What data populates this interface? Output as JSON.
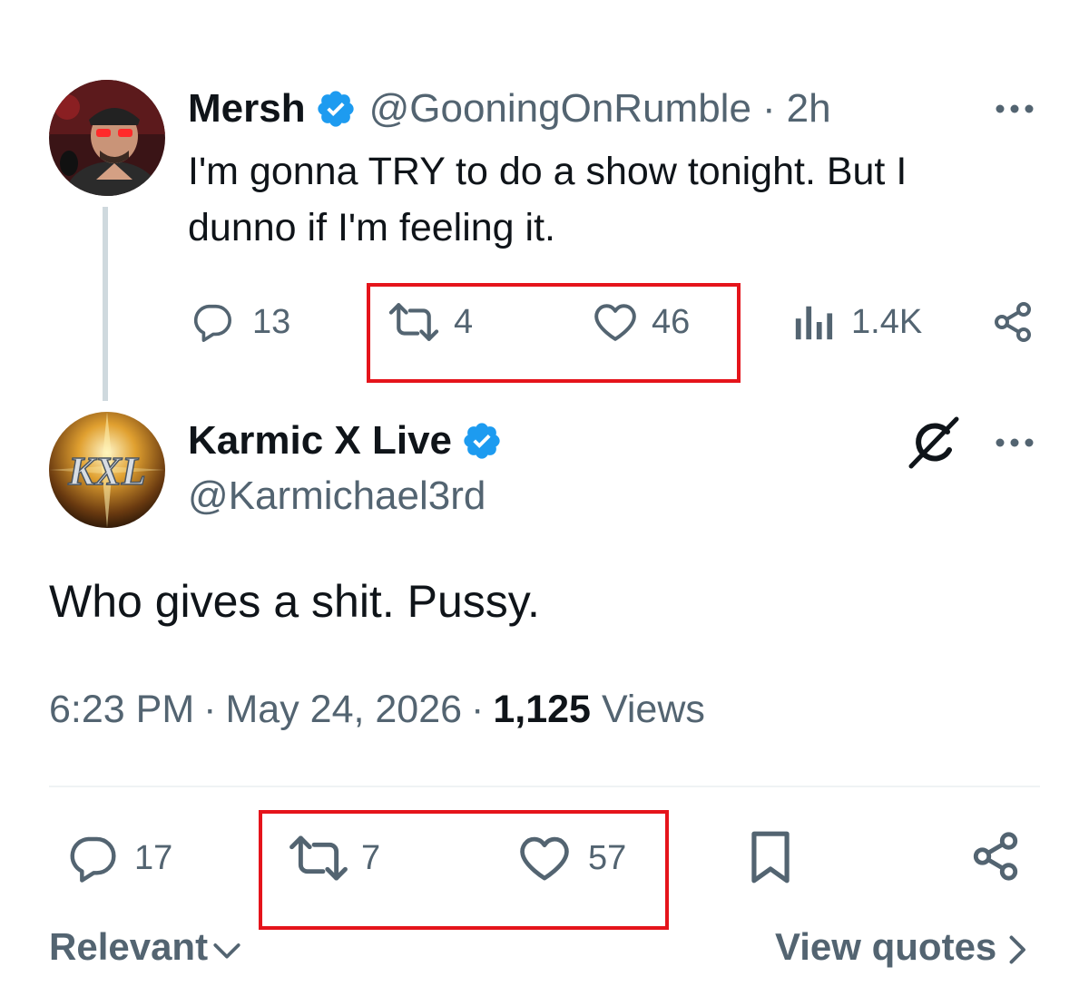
{
  "parent_tweet": {
    "display_name": "Mersh",
    "handle": "@GooningOnRumble",
    "separator": "·",
    "time": "2h",
    "text_line1": "I'm gonna TRY to do a show tonight. But I",
    "text_line2": "dunno if I'm feeling it.",
    "replies": "13",
    "reposts": "4",
    "likes": "46",
    "views": "1.4K"
  },
  "reply_tweet": {
    "display_name": "Karmic X Live",
    "handle": "@Karmichael3rd",
    "avatar_text": "KXL",
    "text": "Who gives a shit. Pussy.",
    "time": "6:23 PM",
    "sep1": "·",
    "date": "May 24, 2026",
    "sep2": "·",
    "views_count": "1,125",
    "views_label": "Views",
    "replies": "17",
    "reposts": "7",
    "likes": "57"
  },
  "footer": {
    "sort_label": "Relevant",
    "view_quotes_label": "View quotes"
  },
  "colors": {
    "verified_blue": "#1d9bf0",
    "highlight_red": "#e5141b",
    "muted_text": "#536471",
    "primary_text": "#0f1419"
  },
  "icons": [
    "reply-icon",
    "repost-icon",
    "like-icon",
    "views-icon",
    "share-icon",
    "bookmark-icon",
    "more-icon",
    "verified-icon",
    "grok-icon",
    "chevron-down-icon",
    "chevron-right-icon"
  ]
}
